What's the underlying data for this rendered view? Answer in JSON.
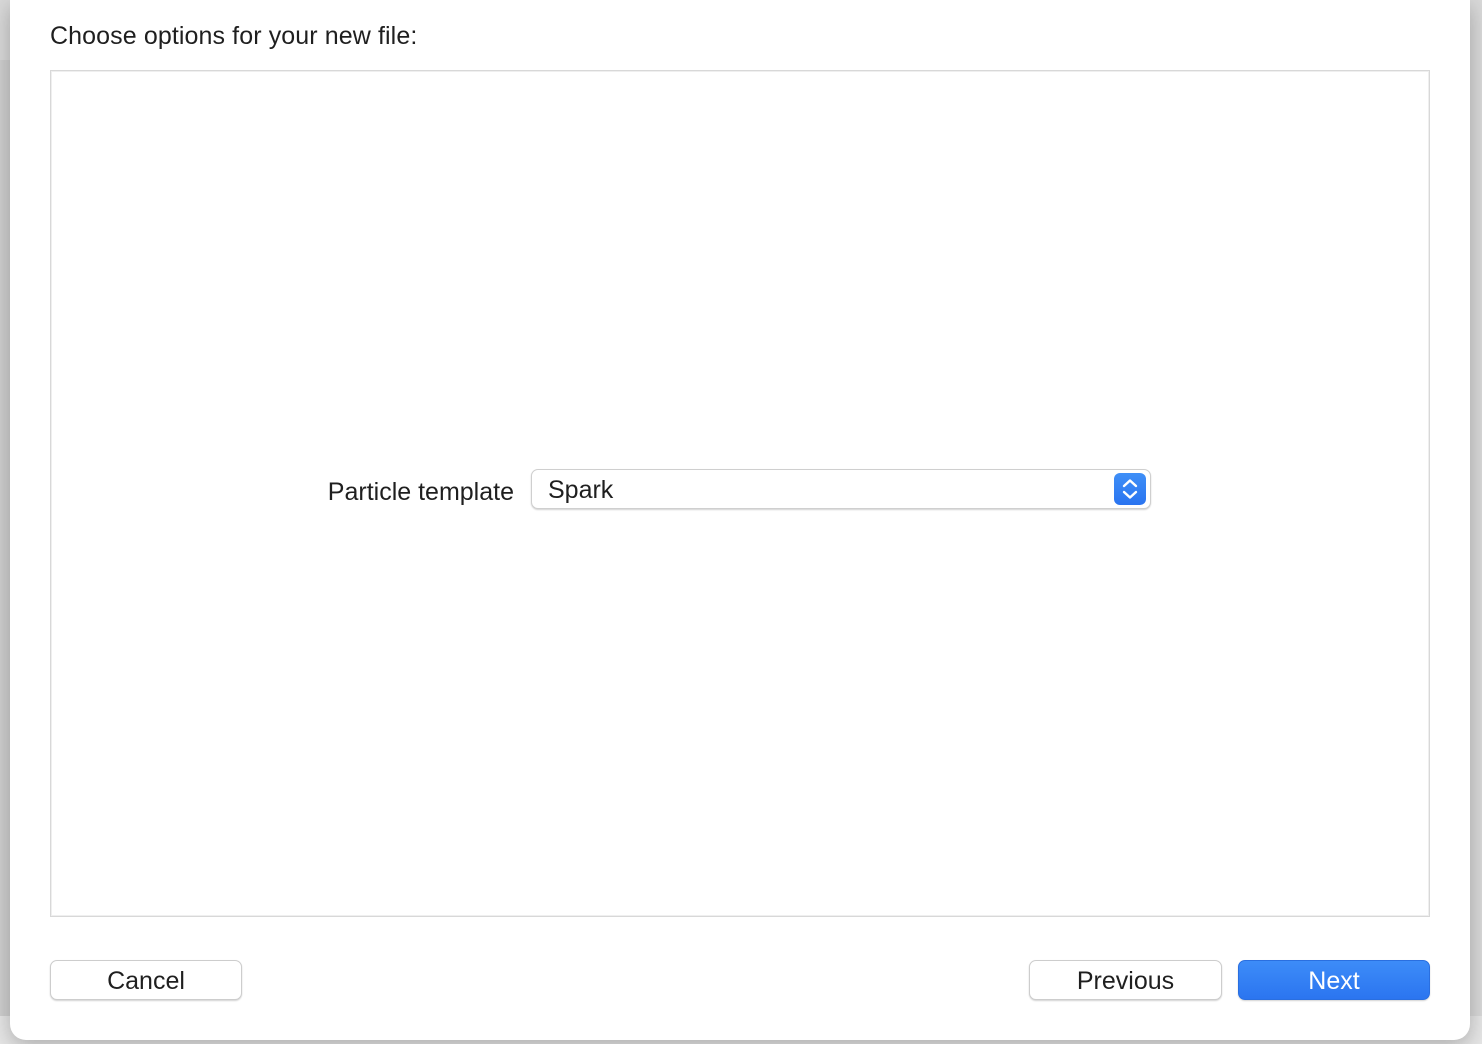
{
  "dialog": {
    "title": "Choose options for your new file:"
  },
  "options": {
    "particle_template": {
      "label": "Particle template",
      "selected": "Spark"
    }
  },
  "buttons": {
    "cancel": "Cancel",
    "previous": "Previous",
    "next": "Next"
  },
  "colors": {
    "accent": "#2b75f0",
    "sheet_background": "#ffffff",
    "panel_border": "#d8d8d8"
  },
  "icons": {
    "popup_indicator": "chevron-up-down-icon"
  }
}
